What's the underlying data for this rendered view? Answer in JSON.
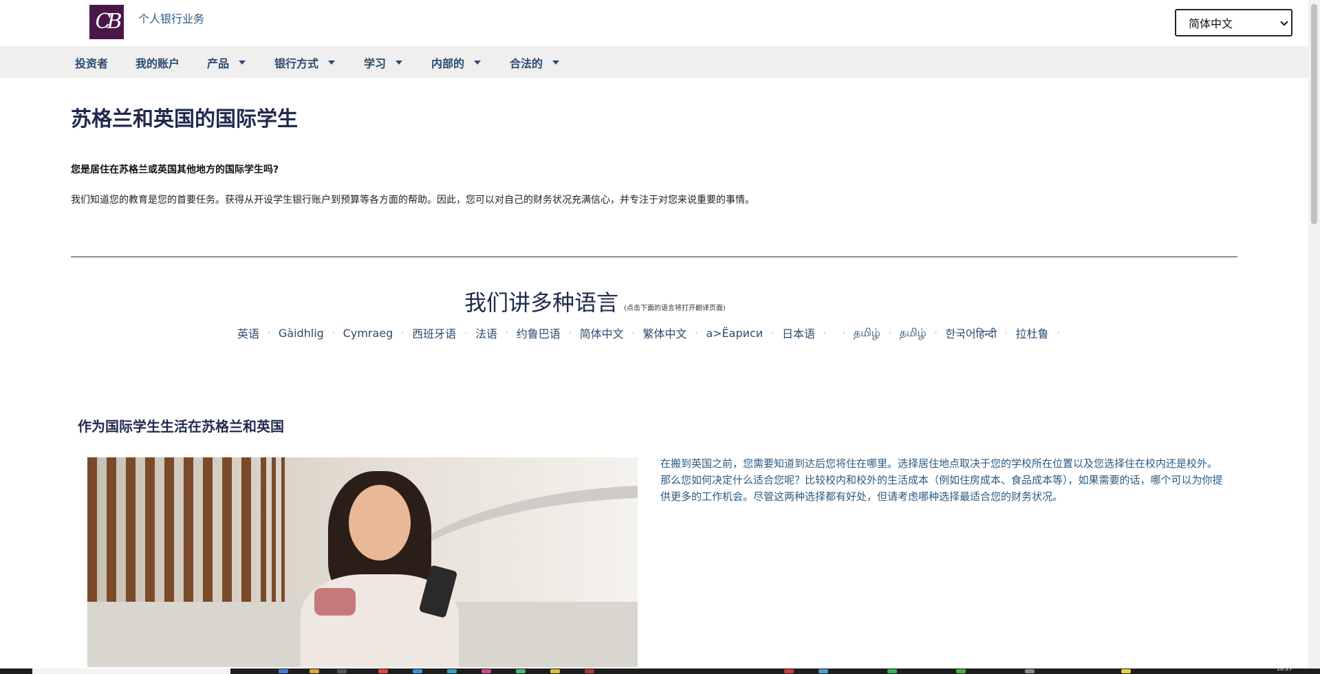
{
  "header": {
    "logo_text": "CB",
    "brand_subtitle": "个人银行业务",
    "language_selected": "简体中文"
  },
  "nav": {
    "items": [
      {
        "label": "投资者",
        "has_dropdown": false
      },
      {
        "label": "我的账户",
        "has_dropdown": false
      },
      {
        "label": "产品",
        "has_dropdown": true
      },
      {
        "label": "银行方式",
        "has_dropdown": true
      },
      {
        "label": "学习",
        "has_dropdown": true
      },
      {
        "label": "内部的",
        "has_dropdown": true
      },
      {
        "label": "合法的",
        "has_dropdown": true
      }
    ]
  },
  "main": {
    "title": "苏格兰和英国的国际学生",
    "question": "您是居住在苏格兰或英国其他地方的国际学生吗?",
    "intro": "我们知道您的教育是您的首要任务。获得从开设学生银行账户到预算等各方面的帮助。因此，您可以对自己的财务状况充满信心，并专注于对您来说重要的事情。"
  },
  "languages": {
    "heading": "我们讲多种语言",
    "hint": "(点击下面的语言将打开翻译页面)",
    "links": [
      "英语",
      "Gàidhlig",
      "Cymraeg",
      "西班牙语",
      "法语",
      "约鲁巴语",
      "简体中文",
      "繁体中文",
      "a>Ёариси",
      "日本语",
      "",
      "தமிழ்",
      "தமிழ்",
      "한국어हिन्दी",
      "拉杜鲁"
    ]
  },
  "section": {
    "title": "作为国际学生生活在苏格兰和英国",
    "body": "在搬到英国之前，您需要知道到达后您将住在哪里。选择居住地点取决于您的学校所在位置以及您选择住在校内还是校外。那么您如何决定什么适合您呢？比较校内和校外的生活成本（例如住房成本、食品成本等），如果需要的话，哪个可以为你提供更多的工作机会。尽管这两种选择都有好处，但请考虑哪种选择最适合您的财务状况。"
  },
  "taskbar": {
    "clock": "10:27"
  },
  "colors": {
    "logo_bg": "#4a1848",
    "nav_bg": "#efefef",
    "link": "#2a4b6f",
    "heading": "#1f2a4e"
  }
}
